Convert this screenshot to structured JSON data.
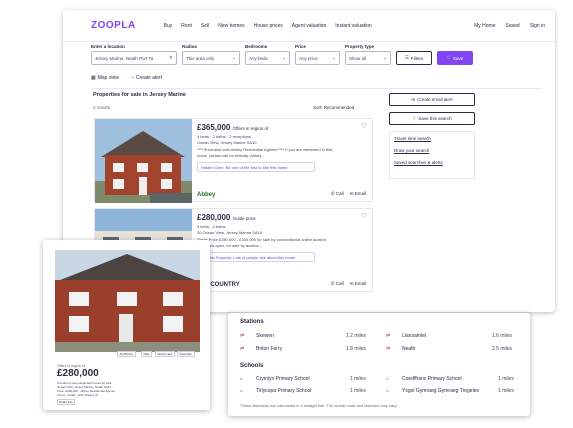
{
  "nav": {
    "logo": "ZOOPLA",
    "links": [
      "Buy",
      "Rent",
      "Sell",
      "New homes",
      "House prices",
      "Agent valuation",
      "Instant valuation"
    ],
    "right": [
      "My Home",
      "Saved",
      "Sign in"
    ]
  },
  "filters": {
    "location_label": "Enter a location",
    "location_value": "Jersey Marine, Neath Port Ta",
    "radius_label": "Radius",
    "radius_value": "This area only",
    "bedrooms_label": "Bedrooms",
    "bedrooms_value": "Any beds",
    "price_label": "Price",
    "price_value": "Any price",
    "type_label": "Property type",
    "type_value": "Show all",
    "filters_button": "Filters",
    "save_button": "Save"
  },
  "subbar": {
    "map_view": "Map view",
    "create_alert": "Create alert"
  },
  "results": {
    "title": "Properties for sale in Jersey Marine",
    "count": "2 results",
    "sort": "Sort: Recommended"
  },
  "listings": [
    {
      "price": "£365,000",
      "price_qualifier": "Offers in region of",
      "rooms": "4 beds · 2 baths · 2 receptions",
      "address": "Ocean View, Jersey Marine SA10",
      "desc1": "*****Exclusive with Abbey Residential Agents***** If you are interested in this",
      "desc2": "home, please call us verbally. Abbey...",
      "pill": "Hidden Gem: Be one of the first to see this home",
      "agent": "Abbey",
      "call": "Call",
      "email": "Email"
    },
    {
      "price": "£280,000",
      "price_qualifier": "Guide price",
      "rooms": "3 beds · 2 baths",
      "address": "20 Ocean View, Jersey Marine SA10",
      "desc1": "Guide Price £280,000 - £300,000 for sale by unconditional online auction,",
      "desc2": "...bid now open, for sale by auction...",
      "pill": "Popular Property: Lots of people ask about this home",
      "agent": "TN · COUNTRY",
      "call": "Call",
      "email": "Email"
    }
  ],
  "sidebar": {
    "create_email_alert": "Create email alert",
    "save_search": "Save this search",
    "links": [
      "Travel time search",
      "Draw your search",
      "Saved searches & alerts"
    ]
  },
  "mobile": {
    "photo_buttons": [
      "20 Photos",
      "Map",
      "Street view",
      "Floorplan"
    ],
    "prefix": "Offers in region of",
    "price": "£280,000",
    "line1": "3 bedroom semi-detached house for sale",
    "line2": "Ocean Park, Jersey Marine, Neath SA10",
    "line3": "Price: £280,000 · Abbey Residential Agents",
    "line4": "3 bed · 2 bath · EPC Rating: B",
    "tag": "Chain free"
  },
  "stations": {
    "title": "Stations",
    "items": [
      {
        "name": "Skewen",
        "distance": "1.2 miles"
      },
      {
        "name": "Briton Ferry",
        "distance": "1.8 miles"
      },
      {
        "name": "Llansamlet",
        "distance": "1.6 miles"
      },
      {
        "name": "Neath",
        "distance": "2.5 miles"
      }
    ]
  },
  "schools": {
    "title": "Schools",
    "items": [
      {
        "name": "Crymlyn Primary School",
        "distance": "1 miles"
      },
      {
        "name": "Tirlycopa Primary School",
        "distance": "1 miles"
      },
      {
        "name": "Coedffranc Primary School",
        "distance": "1 miles"
      },
      {
        "name": "Ysgol Gymraeg Gymraeg Tregeles",
        "distance": "1 miles"
      }
    ]
  },
  "note": "These distances are calculated in a straight line. The actual route and distance may vary.",
  "colors": {
    "brand": "#8046f1",
    "text": "#322744",
    "rail": "#d21f3c"
  }
}
